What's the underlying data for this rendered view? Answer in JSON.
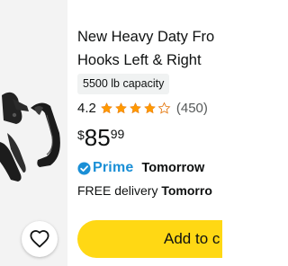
{
  "product": {
    "title_line1": "New Heavy Daty Fro",
    "title_line2": "Hooks Left & Right",
    "capacity_badge": "5500 lb capacity",
    "rating_value": "4.2",
    "rating_stars": 4.2,
    "rating_count": "(450)",
    "price_symbol": "$",
    "price_whole": "85",
    "price_fraction": "99",
    "prime_label": "Prime",
    "prime_delivery_day": "Tomorrow",
    "free_delivery_text": "FREE delivery ",
    "free_delivery_day": "Tomorro"
  },
  "actions": {
    "add_to_cart_label": "Add to c"
  },
  "icons": {
    "wishlist": "heart-outline-icon",
    "prime": "prime-check-icon",
    "star": "star-icon"
  },
  "colors": {
    "star": "#ff9900",
    "prime_blue": "#1a8fd6",
    "cart_button": "#ffd814",
    "image_bg": "#f3f3f3",
    "badge_bg": "#f0f2f2"
  }
}
